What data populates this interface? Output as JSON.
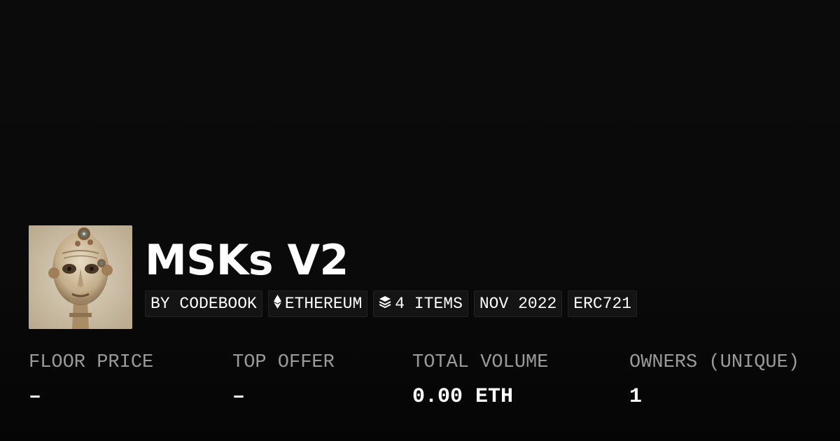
{
  "collection": {
    "title": "MSKs V2",
    "avatar_icon": "masked-face-artwork"
  },
  "tags": [
    {
      "label": "BY CODEBOOK",
      "icon": ""
    },
    {
      "label": "ETHEREUM",
      "icon": "ethereum-icon"
    },
    {
      "label": "4 ITEMS",
      "icon": "layers-icon"
    },
    {
      "label": "NOV 2022",
      "icon": ""
    },
    {
      "label": "ERC721",
      "icon": ""
    }
  ],
  "stats": [
    {
      "label": "FLOOR PRICE",
      "value": "–"
    },
    {
      "label": "TOP OFFER",
      "value": "–"
    },
    {
      "label": "TOTAL VOLUME",
      "value": "0.00 ETH"
    },
    {
      "label": "OWNERS (UNIQUE)",
      "value": "1"
    }
  ],
  "colors": {
    "background": "#0a0a0a",
    "text": "#ffffff",
    "muted": "#9a9a9a",
    "tag_bg": "#141414"
  }
}
